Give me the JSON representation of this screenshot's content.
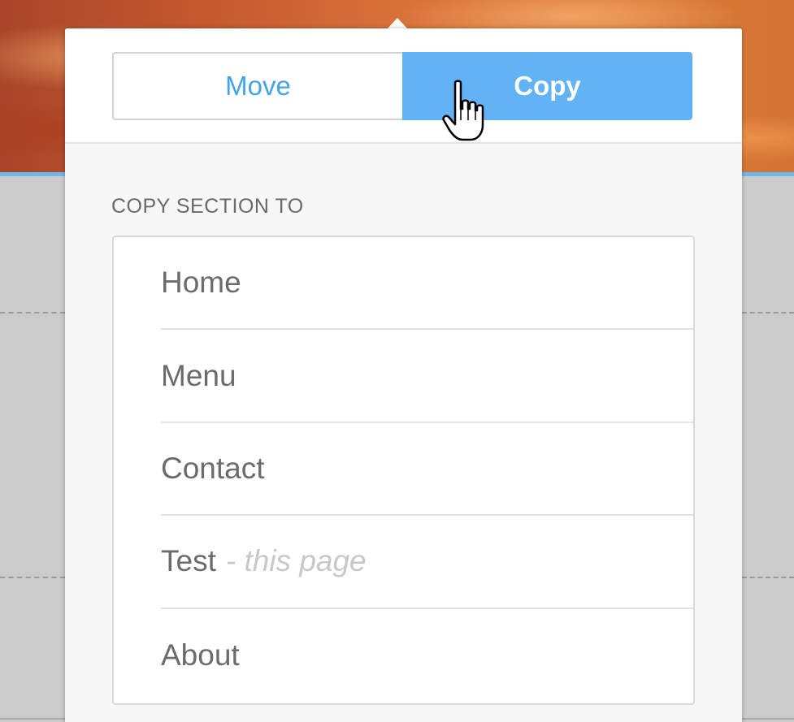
{
  "toggle": {
    "move_label": "Move",
    "copy_label": "Copy",
    "active": "Copy"
  },
  "section": {
    "title": "COPY SECTION TO"
  },
  "pages": [
    {
      "label": "Home",
      "suffix": ""
    },
    {
      "label": "Menu",
      "suffix": ""
    },
    {
      "label": "Contact",
      "suffix": ""
    },
    {
      "label": "Test",
      "suffix": "- this page"
    },
    {
      "label": "About",
      "suffix": ""
    }
  ],
  "colors": {
    "accent": "#62b2f5",
    "move_text": "#45a4e8",
    "hero_orange": "#d9713a"
  },
  "icons": {
    "cursor": "hand-pointer-icon"
  }
}
